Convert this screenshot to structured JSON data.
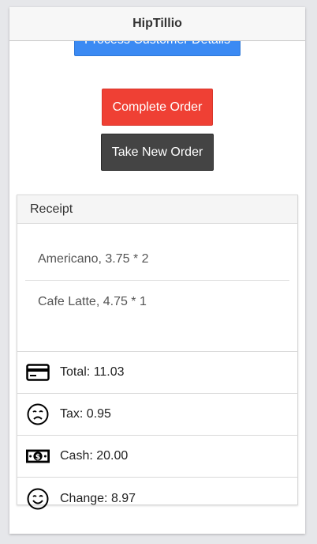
{
  "nav": {
    "title": "HipTillio"
  },
  "buttons": {
    "process_label": "Process Customer Details",
    "complete_label": "Complete Order",
    "new_order_label": "Take New Order"
  },
  "receipt": {
    "header": "Receipt",
    "items": [
      {
        "label": "Americano, 3.75 * 2"
      },
      {
        "label": "Cafe Latte, 4.75 * 1"
      }
    ],
    "summary": [
      {
        "icon": "credit-card-icon",
        "label": "Total: 11.03"
      },
      {
        "icon": "sad-face-icon",
        "label": "Tax: 0.95"
      },
      {
        "icon": "cash-icon",
        "label": "Cash: 20.00"
      },
      {
        "icon": "smile-face-icon",
        "label": "Change: 8.97"
      }
    ]
  },
  "colors": {
    "primary_button": "#3b8af3",
    "danger_button": "#ef4034",
    "dark_button": "#444444"
  }
}
